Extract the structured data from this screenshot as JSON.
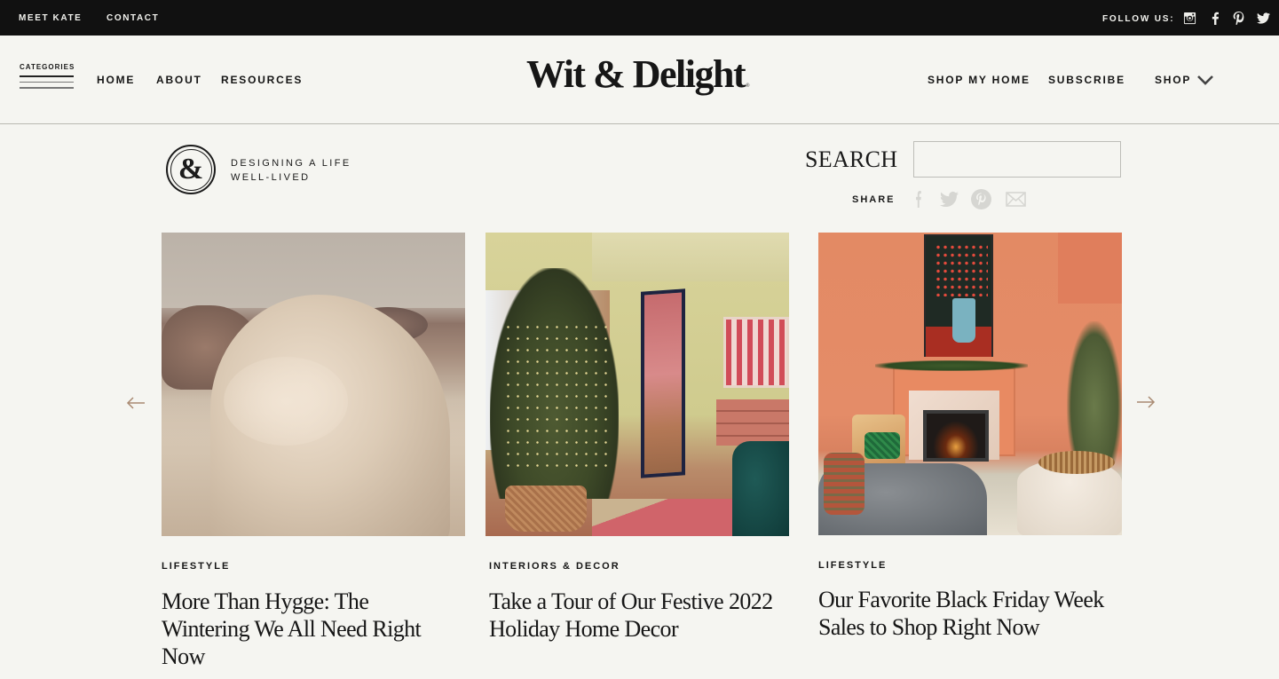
{
  "topbar": {
    "links": [
      "MEET KATE",
      "CONTACT"
    ],
    "follow_label": "FOLLOW US:",
    "social_icons": [
      "instagram-icon",
      "facebook-icon",
      "pinterest-icon",
      "twitter-icon"
    ]
  },
  "header": {
    "categories_label": "CATEGORIES",
    "nav_left": [
      "HOME",
      "ABOUT",
      "RESOURCES"
    ],
    "logo": "Wit & Delight",
    "logo_mark": "®",
    "nav_right": [
      "SHOP MY HOME",
      "SUBSCRIBE",
      "SHOP"
    ]
  },
  "tagline": {
    "badge_glyph": "&",
    "line1": "DESIGNING A LIFE",
    "line2": "WELL-LIVED"
  },
  "search": {
    "label": "SEARCH",
    "value": "",
    "placeholder": ""
  },
  "share": {
    "label": "SHARE",
    "icons": [
      "facebook-icon",
      "twitter-icon",
      "pinterest-icon",
      "email-icon"
    ]
  },
  "carousel": {
    "prev_icon": "arrow-left-icon",
    "next_icon": "arrow-right-icon",
    "posts": [
      {
        "category": "LIFESTYLE",
        "title": "More Than Hygge: The Wintering We All Need Right Now",
        "image_alt": "Rumpled duvet on an unmade bed"
      },
      {
        "category": "INTERIORS & DECOR",
        "title": "Take a Tour of Our Festive 2022 Holiday Home Decor",
        "image_alt": "Decorated Christmas tree in a yellow living room with a garland-wrapped mirror"
      },
      {
        "category": "LIFESTYLE",
        "title": "Our Favorite Black Friday Week Sales to Shop Right Now",
        "image_alt": "Orange living room with fireplace, garland and Christmas tree"
      }
    ]
  },
  "colors": {
    "topbar_bg": "#111111",
    "page_bg": "#f5f5f1",
    "text": "#161616",
    "arrow": "#a98a72",
    "share_icon": "#d6d6d2"
  }
}
